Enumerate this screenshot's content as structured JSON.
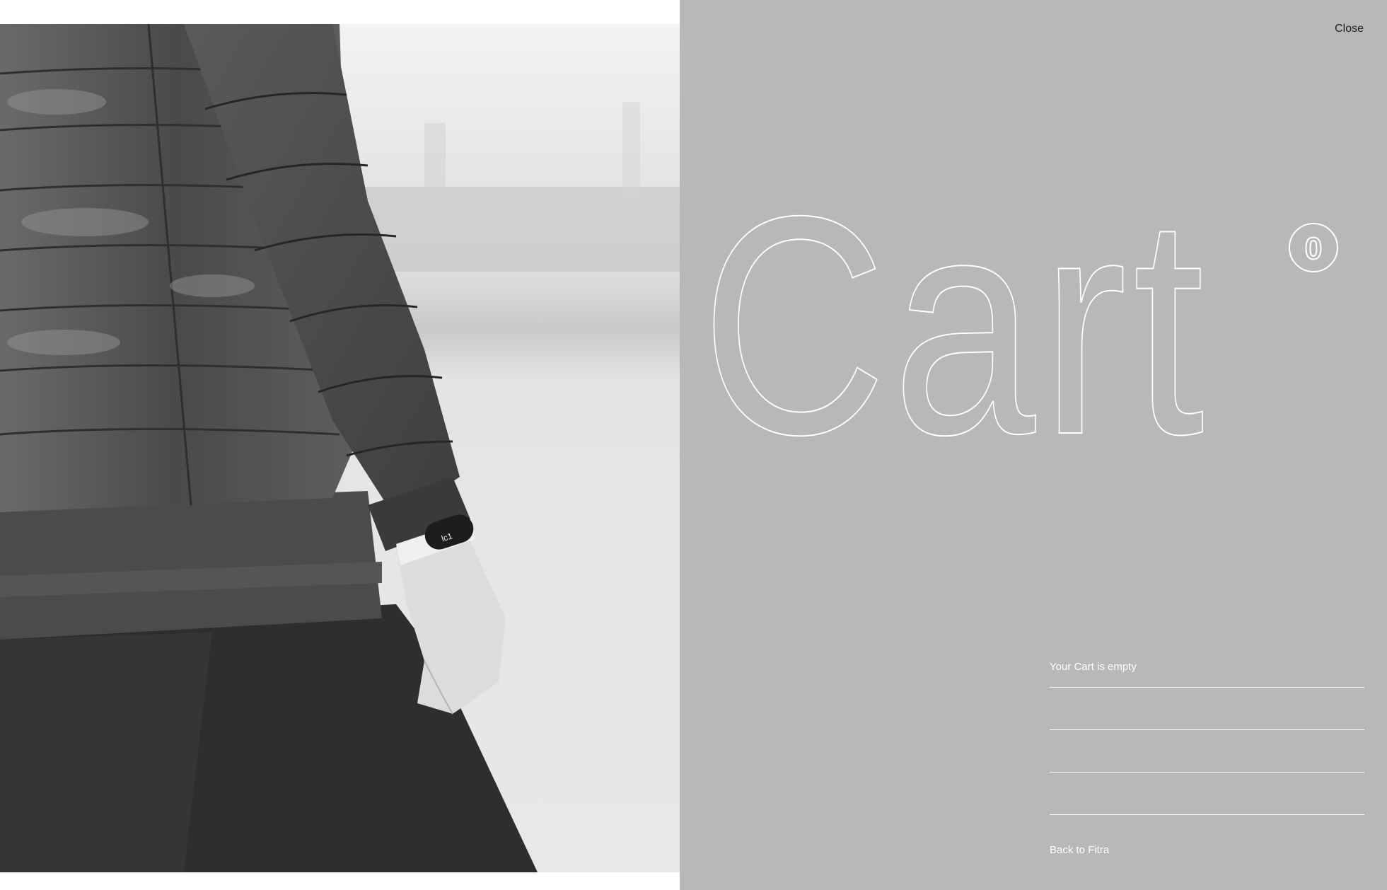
{
  "photo": {
    "icon": "product-lifestyle-photo",
    "tracker_display_text": "lc1"
  },
  "cart": {
    "heading": "Cart",
    "count": "0",
    "empty_message": "Your Cart is empty",
    "close_label": "Close",
    "back_label": "Back to Fitra"
  },
  "colors": {
    "panel_background": "#b8b8b8",
    "heading_outline": "#ffffff",
    "text_dark": "#1e1e1e",
    "text_light": "#ffffff"
  }
}
